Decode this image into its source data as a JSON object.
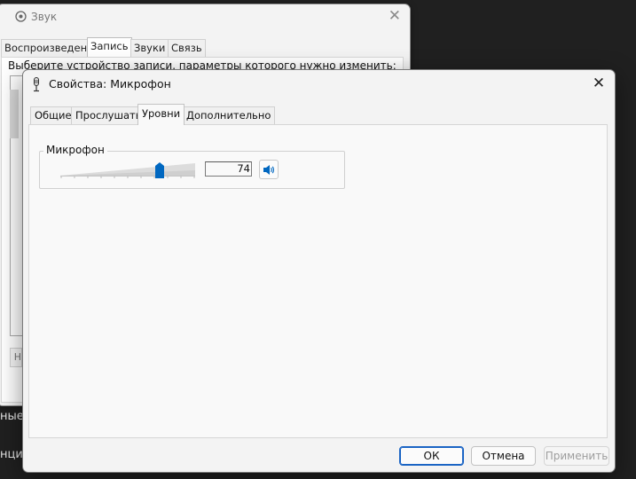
{
  "background": {
    "snippet_1": "ные",
    "snippet_2": "нциа"
  },
  "back_window": {
    "title": "Звук",
    "close": "✕",
    "tabs": [
      "Воспроизведение",
      "Запись",
      "Звуки",
      "Связь"
    ],
    "active_tab": "Запись",
    "description": "Выберите устройство записи, параметры которого нужно изменить:",
    "stub_button": "Н"
  },
  "dialog": {
    "title": "Свойства: Микрофон",
    "close": "✕",
    "tabs": [
      "Общие",
      "Прослушать",
      "Уровни",
      "Дополнительно"
    ],
    "active_tab": "Уровни",
    "levels": {
      "group_label": "Микрофон",
      "value": "74",
      "level_percent": 74
    },
    "buttons": {
      "ok": "ОК",
      "cancel": "Отмена",
      "apply": "Применить"
    }
  },
  "colors": {
    "accent": "#0067c0",
    "desktop": "#202020"
  }
}
